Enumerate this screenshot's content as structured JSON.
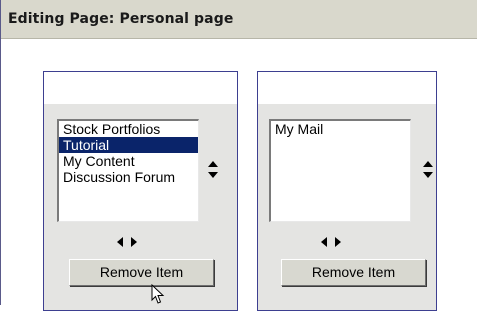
{
  "header": {
    "title": "Editing Page: Personal page"
  },
  "left_panel": {
    "items": [
      "Stock Portfolios",
      "Tutorial",
      "My Content",
      "Discussion Forum"
    ],
    "selected_index": 1,
    "remove_label": "Remove Item"
  },
  "right_panel": {
    "items": [
      "My Mail"
    ],
    "remove_label": "Remove Item"
  },
  "icons": {
    "up_down": "up-down-arrows-icon",
    "left_right": "left-right-arrows-icon",
    "cursor": "mouse-pointer-icon"
  },
  "colors": {
    "title_bg": "#d9d8cc",
    "panel_bg": "#e4e4e2",
    "selection_bg": "#0a246a",
    "panel_border": "#3d3f90"
  }
}
